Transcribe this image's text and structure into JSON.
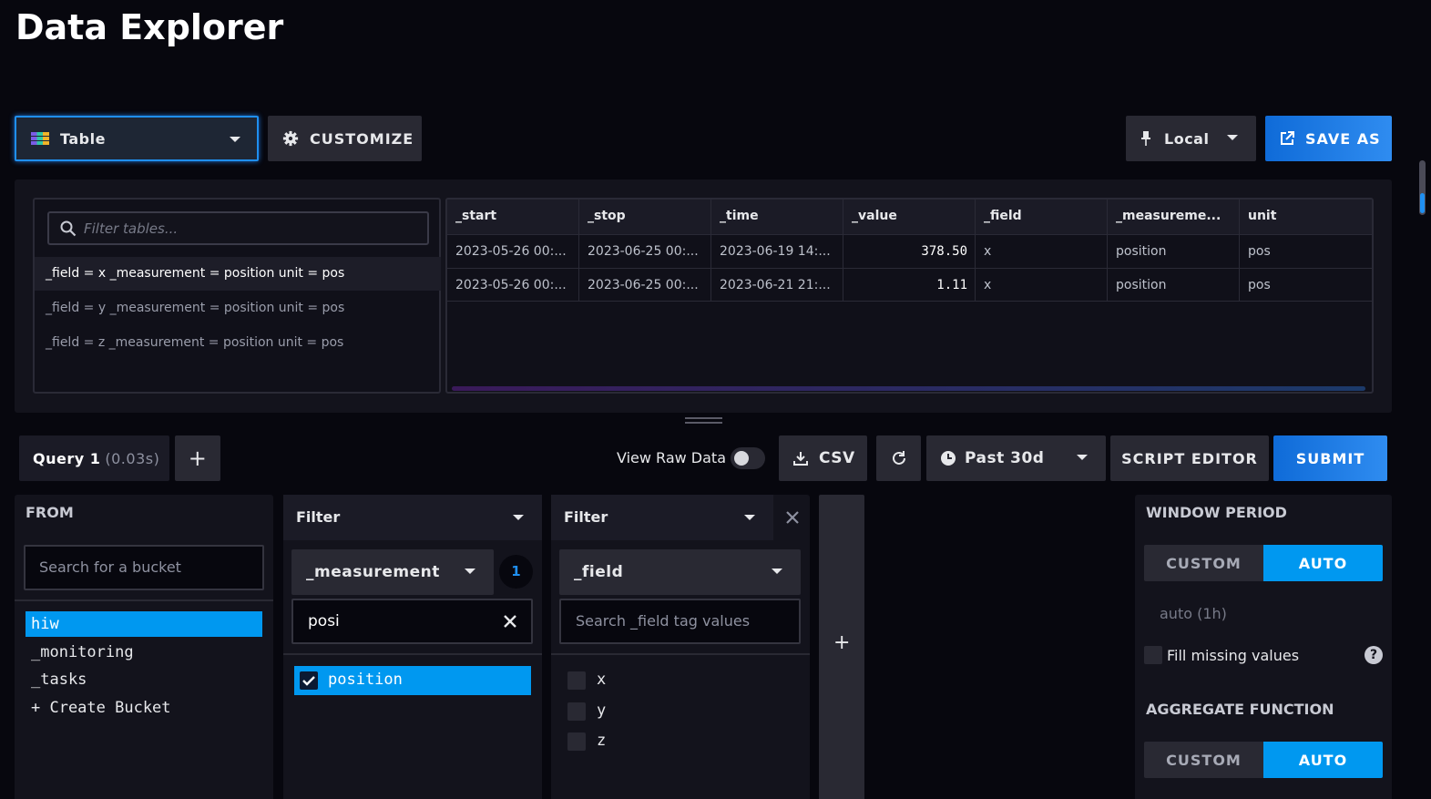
{
  "page_title": "Data Explorer",
  "toolbar": {
    "view_type": "Table",
    "customize_label": "CUSTOMIZE",
    "timezone": "Local",
    "save_as_label": "SAVE AS"
  },
  "table_panel": {
    "filter_placeholder": "Filter tables...",
    "series": [
      "_field = x _measurement = position unit = pos",
      "_field = y _measurement = position unit = pos",
      "_field = z _measurement = position unit = pos"
    ],
    "columns": [
      "_start",
      "_stop",
      "_time",
      "_value",
      "_field",
      "_measureme...",
      "unit"
    ],
    "rows": [
      [
        "2023-05-26 00:...",
        "2023-06-25 00:...",
        "2023-06-19 14:...",
        "378.50",
        "x",
        "position",
        "pos"
      ],
      [
        "2023-05-26 00:...",
        "2023-06-25 00:...",
        "2023-06-21 21:...",
        "1.11",
        "x",
        "position",
        "pos"
      ]
    ]
  },
  "query_bar": {
    "query_tab_label": "Query 1",
    "query_tab_time": "(0.03s)",
    "add_query": "+",
    "view_raw_label": "View Raw Data",
    "csv_label": "CSV",
    "time_range": "Past 30d",
    "script_editor_label": "SCRIPT EDITOR",
    "submit_label": "SUBMIT"
  },
  "from_panel": {
    "header": "FROM",
    "search_placeholder": "Search for a bucket",
    "buckets": [
      "hiw",
      "_monitoring",
      "_tasks",
      "+ Create Bucket"
    ],
    "selected_bucket": "hiw"
  },
  "filter1": {
    "header": "Filter",
    "key": "_measurement",
    "count_badge": "1",
    "search_value": "posi",
    "values": [
      "position"
    ]
  },
  "filter2": {
    "header": "Filter",
    "key": "_field",
    "search_placeholder": "Search _field tag values",
    "values": [
      "x",
      "y",
      "z"
    ]
  },
  "add_filter": "+",
  "aggregate_panel": {
    "window_period_header": "WINDOW PERIOD",
    "custom_label": "CUSTOM",
    "auto_label": "AUTO",
    "auto_value": "auto (1h)",
    "fill_missing_label": "Fill missing values",
    "help_icon_glyph": "?",
    "aggregate_header": "AGGREGATE FUNCTION",
    "custom_label2": "CUSTOM",
    "auto_label2": "AUTO"
  },
  "colors": {
    "accent_blue": "#0098f0",
    "primary_blue": "#1a7fe8",
    "background": "#07070e",
    "panel": "#13131c"
  }
}
